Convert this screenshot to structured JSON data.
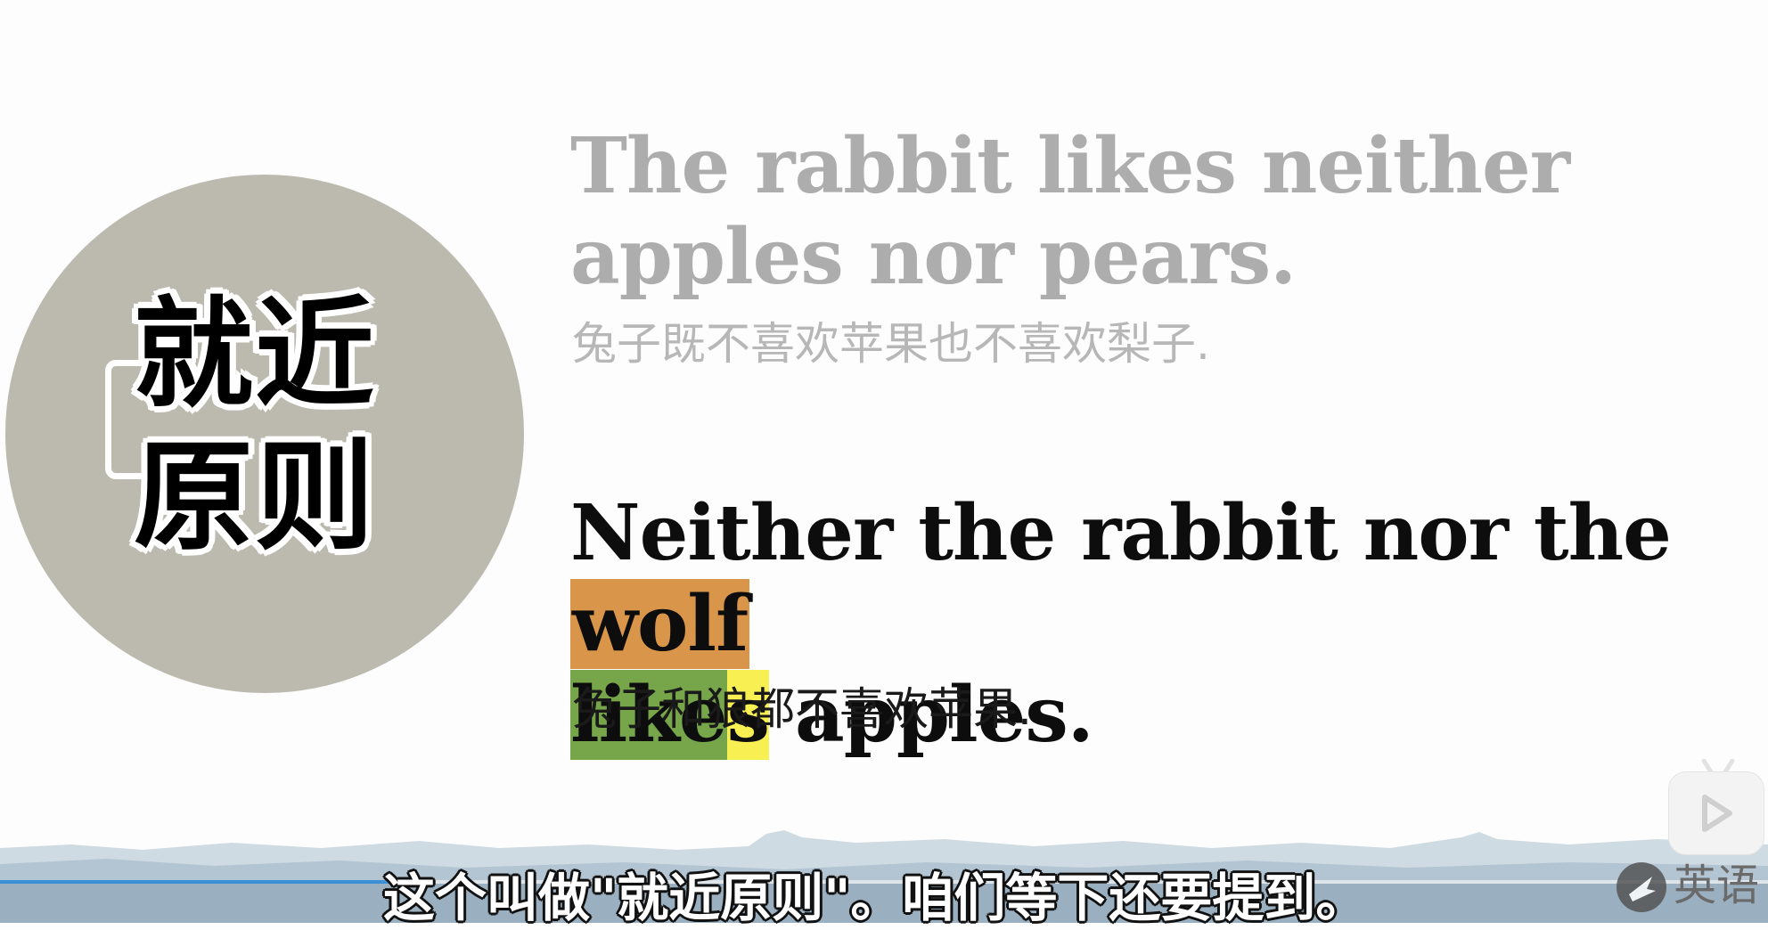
{
  "badge": {
    "line1": "就近",
    "line2": "原则"
  },
  "example1": {
    "english": "The rabbit likes neither apples nor pears.",
    "chinese": "兔子既不喜欢苹果也不喜欢梨子."
  },
  "example2": {
    "part_before": "Neither the rabbit nor the ",
    "highlight_subject": "wolf",
    "verb_stem": "like",
    "verb_suffix": "s",
    "part_after": " apples.",
    "chinese": "兔子和狼都不喜欢苹果."
  },
  "player": {
    "subtitle": "这个叫做\"就近原则\"。咱们等下还要提到。",
    "progress": 0.23,
    "watermark": "英语"
  },
  "colors": {
    "badge_bg": "#bcbaaf",
    "subject_highlight": "#d9954a",
    "verb_highlight": "#76a54a",
    "suffix_highlight": "#f8ef52",
    "progress": "#3b8fd6"
  }
}
